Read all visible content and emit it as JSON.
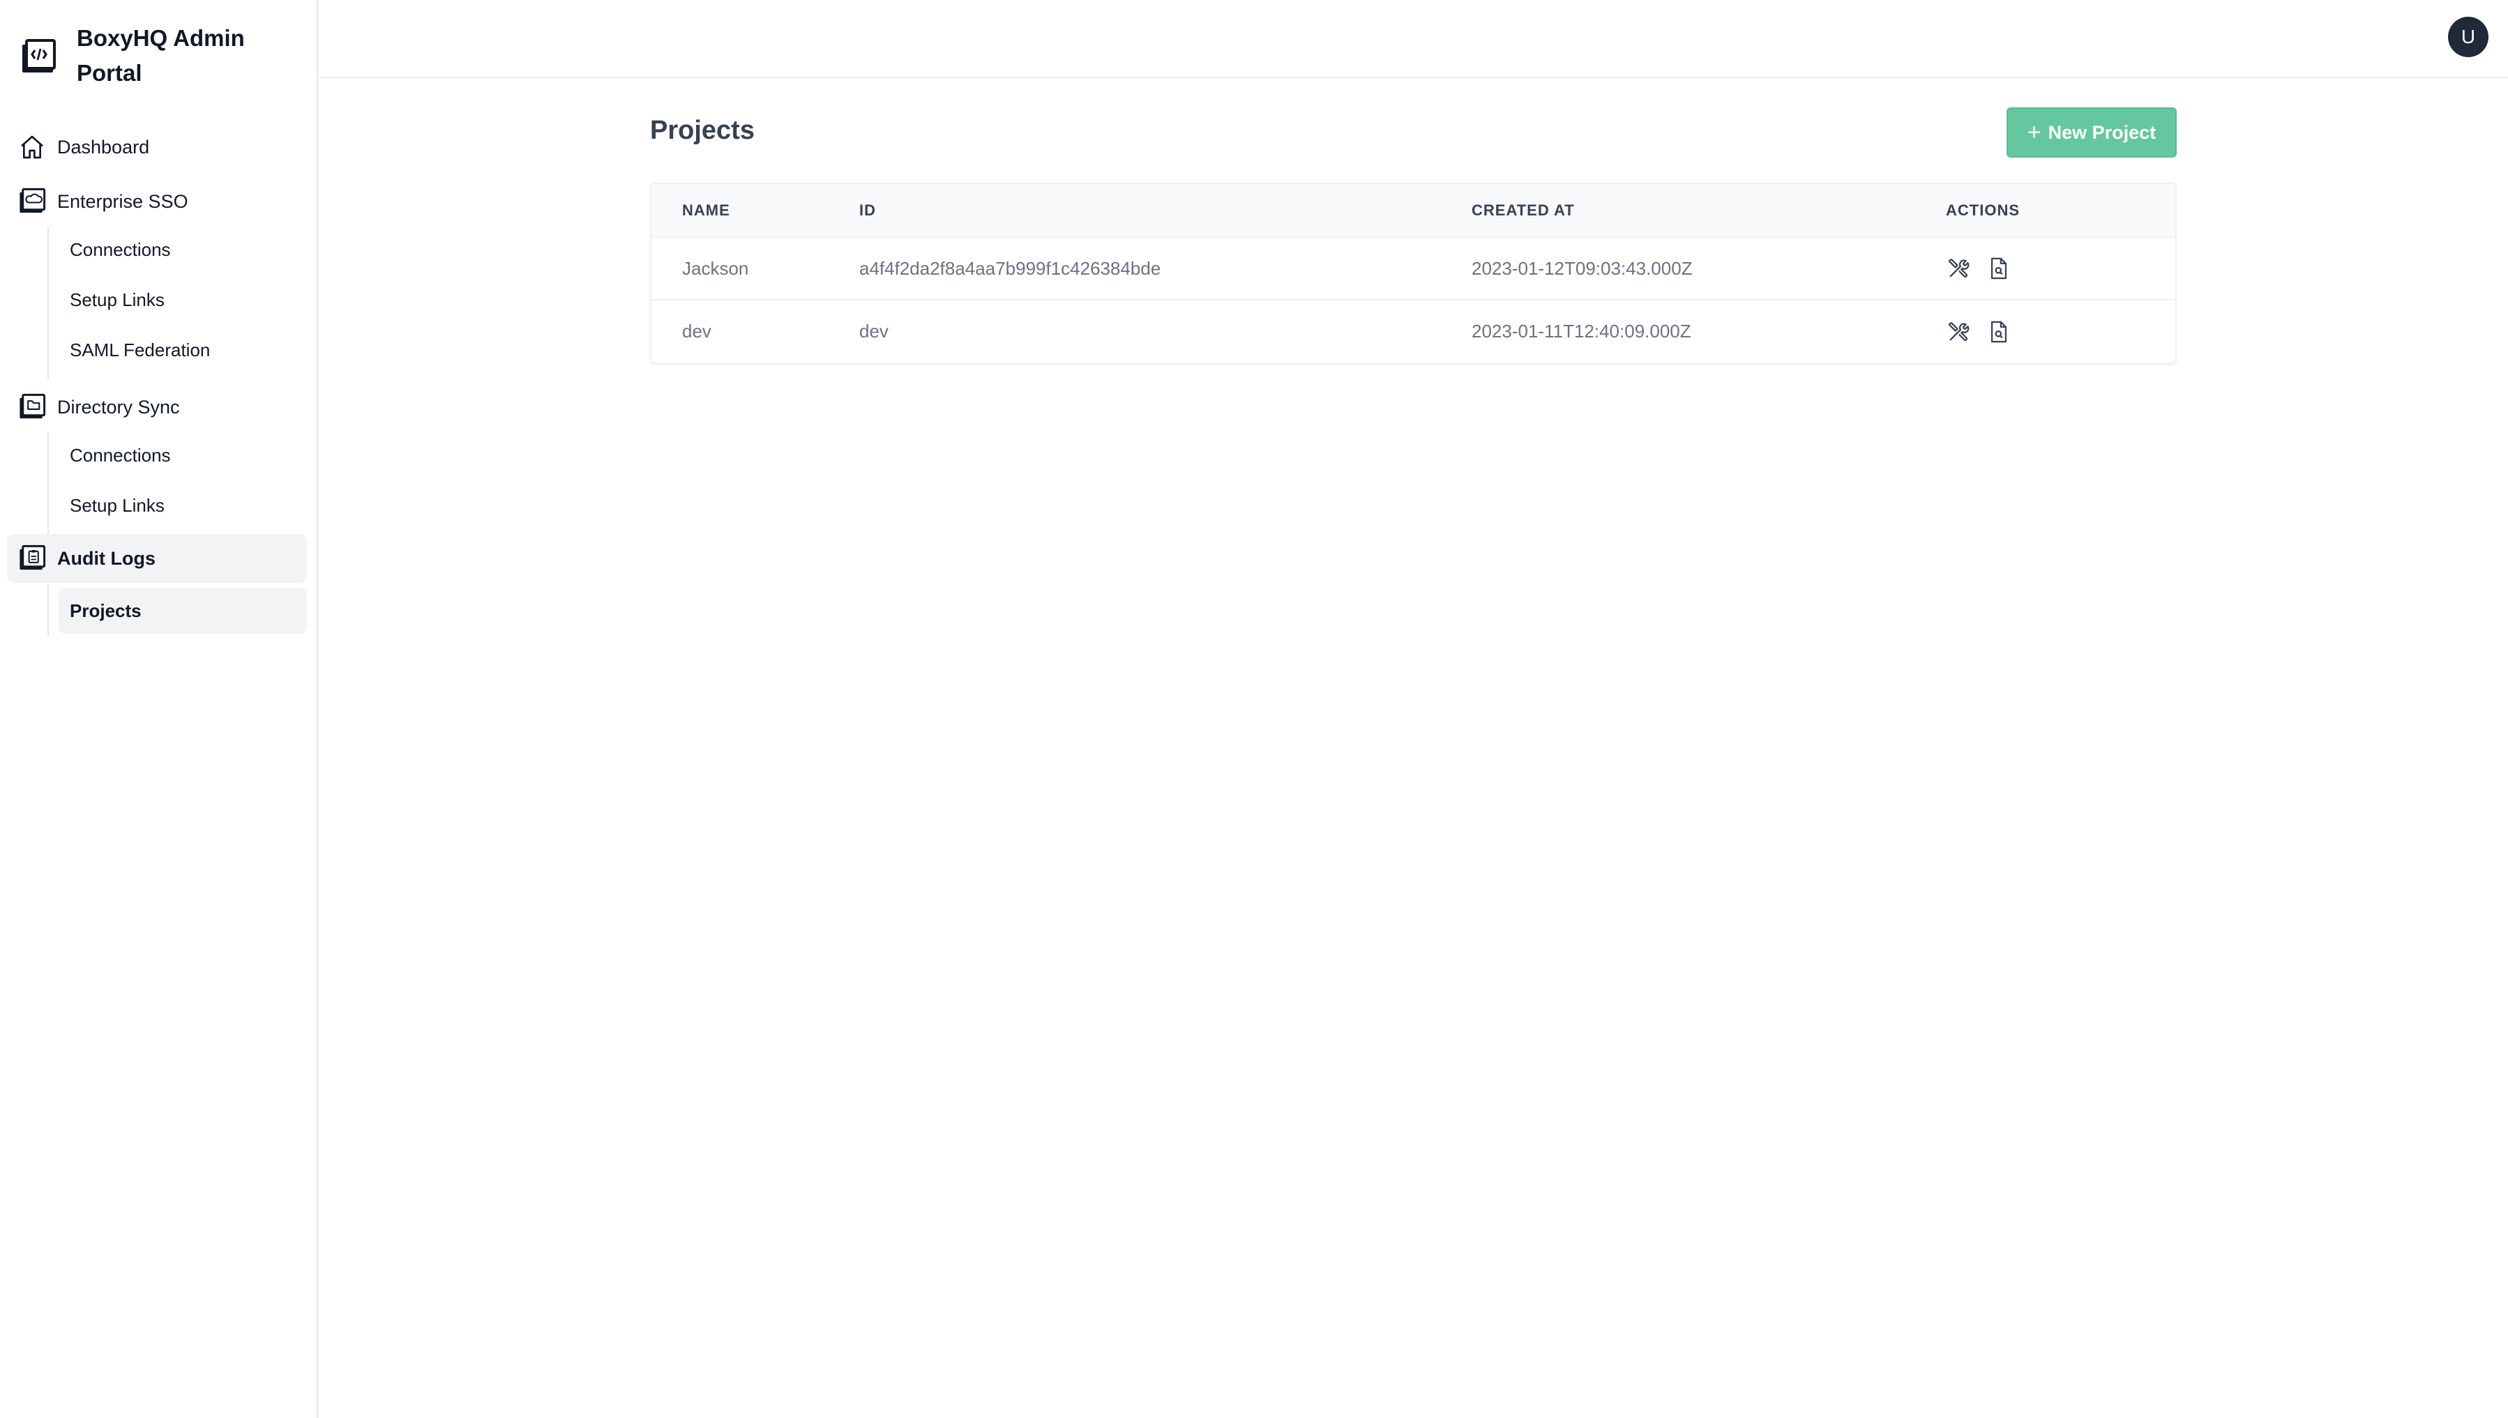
{
  "brand": {
    "title": "BoxyHQ Admin Portal",
    "logo_icon": "code-box-icon"
  },
  "sidebar": {
    "items": [
      {
        "label": "Dashboard",
        "icon": "home-icon"
      },
      {
        "label": "Enterprise SSO",
        "icon": "cloud-box-icon",
        "children": [
          {
            "label": "Connections"
          },
          {
            "label": "Setup Links"
          },
          {
            "label": "SAML Federation"
          }
        ]
      },
      {
        "label": "Directory Sync",
        "icon": "folder-box-icon",
        "children": [
          {
            "label": "Connections"
          },
          {
            "label": "Setup Links"
          }
        ]
      },
      {
        "label": "Audit Logs",
        "icon": "clipboard-box-icon",
        "active": true,
        "children": [
          {
            "label": "Projects",
            "active": true
          }
        ]
      }
    ]
  },
  "header": {
    "avatar_initial": "U"
  },
  "main": {
    "title": "Projects",
    "new_button_label": "New Project",
    "accent_color": "#65c7a0",
    "table": {
      "columns": [
        "NAME",
        "ID",
        "CREATED AT",
        "ACTIONS"
      ],
      "rows": [
        {
          "name": "Jackson",
          "id": "a4f4f2da2f8a4aa7b999f1c426384bde",
          "created_at": "2023-01-12T09:03:43.000Z",
          "actions": [
            "tools-icon",
            "document-search-icon"
          ]
        },
        {
          "name": "dev",
          "id": "dev",
          "created_at": "2023-01-11T12:40:09.000Z",
          "actions": [
            "tools-icon",
            "document-search-icon"
          ]
        }
      ]
    }
  }
}
